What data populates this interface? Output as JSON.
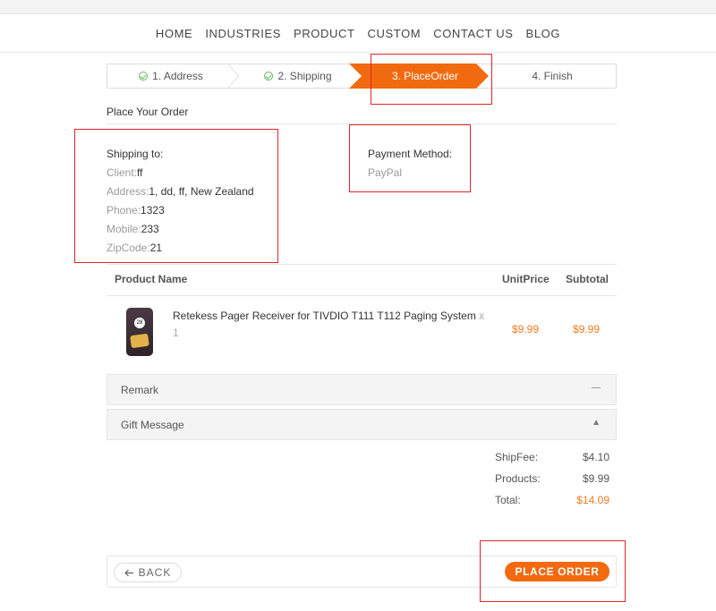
{
  "nav": {
    "items": [
      "HOME",
      "INDUSTRIES",
      "PRODUCT",
      "CUSTOM",
      "CONTACT US",
      "BLOG"
    ]
  },
  "steps": [
    {
      "label": "1. Address",
      "done": true
    },
    {
      "label": "2. Shipping",
      "done": true
    },
    {
      "label": "3. PlaceOrder",
      "active": true
    },
    {
      "label": "4. Finish"
    }
  ],
  "order": {
    "title": "Place Your Order",
    "shipping_heading": "Shipping to:",
    "client_label": "Client:",
    "client": "ff",
    "address_label": "Address:",
    "address": "1, dd, ff, New Zealand",
    "phone_label": "Phone:",
    "phone": "1323",
    "mobile_label": "Mobile:",
    "mobile": "233",
    "zip_label": "ZipCode:",
    "zip": "21",
    "payment_heading": "Payment Method:",
    "payment": "PayPal"
  },
  "table": {
    "headers": {
      "product": "Product Name",
      "unit": "UnitPrice",
      "subtotal": "Subtotal"
    },
    "row": {
      "name": "Retekess Pager Receiver for TIVDIO T111 T112 Paging System",
      "qty_x": "x",
      "qty": "1",
      "unit_price": "$9.99",
      "subtotal": "$9.99",
      "image_badge": "28"
    }
  },
  "accordions": {
    "remark": "Remark",
    "gift": "Gift Message"
  },
  "summary": {
    "shipfee_label": "ShipFee:",
    "shipfee": "$4.10",
    "products_label": "Products:",
    "products": "$9.99",
    "total_label": "Total:",
    "total": "$14.09"
  },
  "actions": {
    "back": "BACK",
    "place": "PLACE ORDER"
  },
  "colors": {
    "accent": "#f26a10",
    "highlight_box": "#e0242b",
    "check": "#5cb85c"
  }
}
